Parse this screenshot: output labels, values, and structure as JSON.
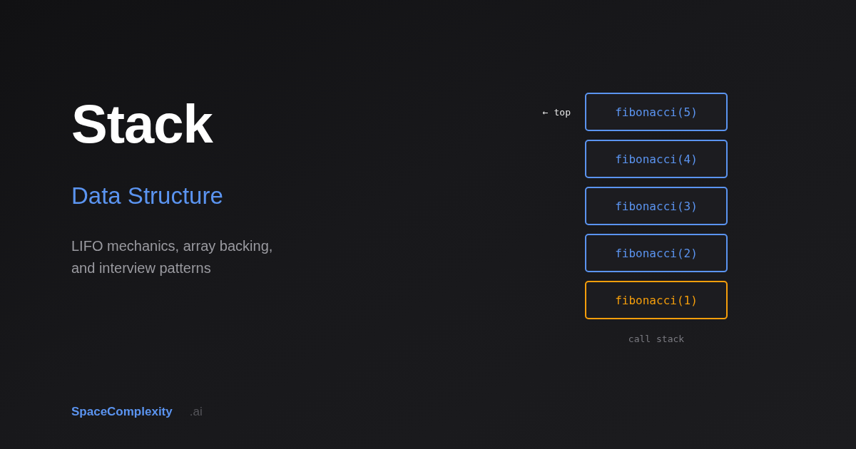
{
  "title": "Stack",
  "subtitle": "Data Structure",
  "description": "LIFO mechanics, array backing, and interview patterns",
  "brand": {
    "name": "SpaceComplexity",
    "suffix": ".ai"
  },
  "stack": {
    "top_marker": "← top",
    "caption": "call stack",
    "frames": [
      {
        "label": "fibonacci(5)",
        "color": "#5b94f0"
      },
      {
        "label": "fibonacci(4)",
        "color": "#5b94f0"
      },
      {
        "label": "fibonacci(3)",
        "color": "#5b94f0"
      },
      {
        "label": "fibonacci(2)",
        "color": "#5b94f0"
      },
      {
        "label": "fibonacci(1)",
        "color": "#f59e0b"
      }
    ]
  }
}
